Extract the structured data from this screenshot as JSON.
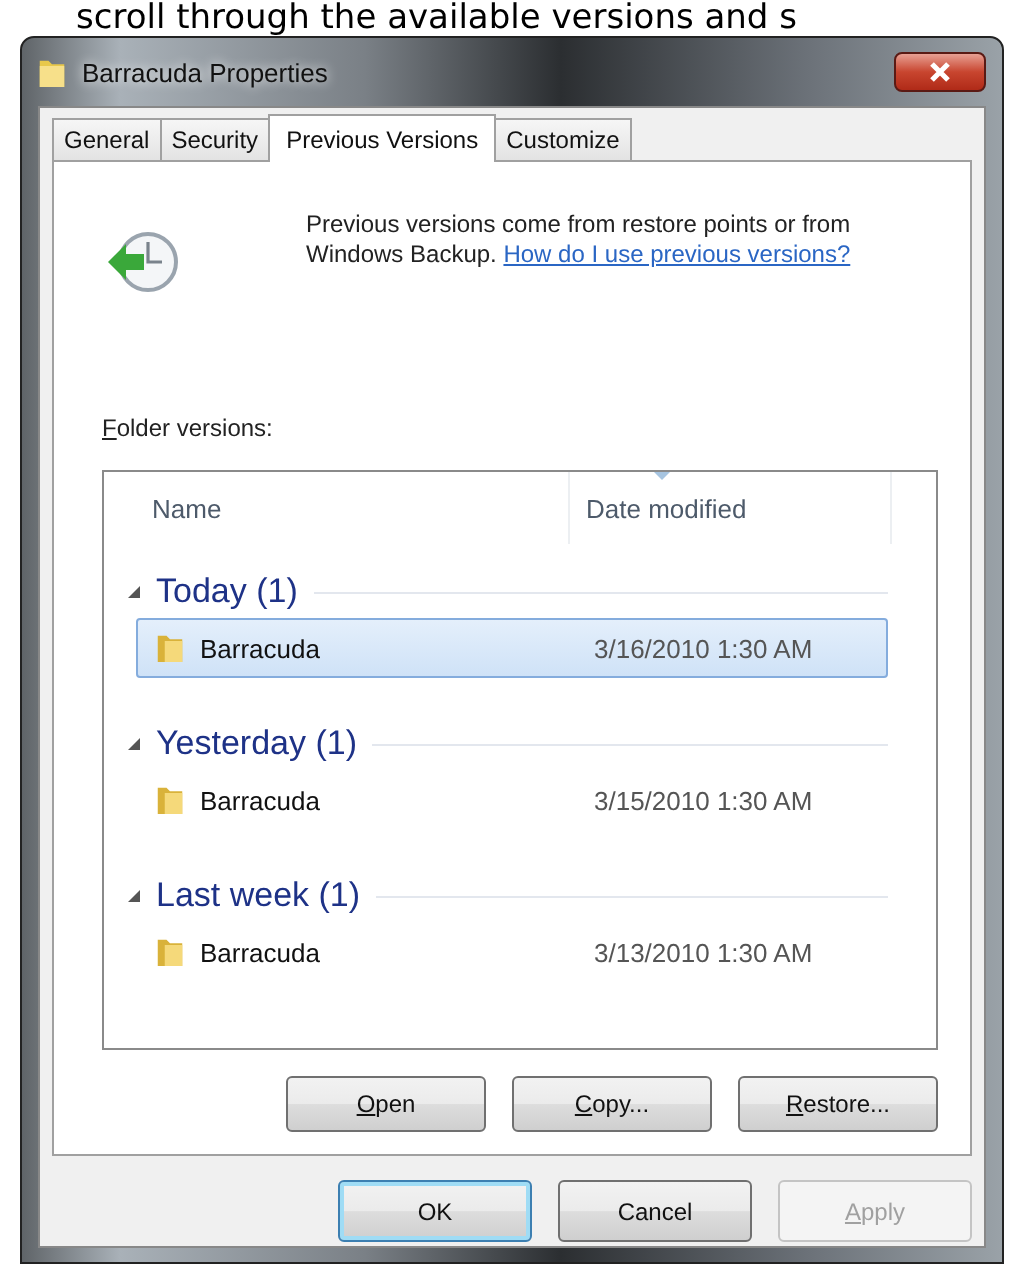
{
  "page_text": "scroll through the available versions and s",
  "window": {
    "title": "Barracuda Properties"
  },
  "tabs": [
    {
      "label": "General",
      "selected": false
    },
    {
      "label": "Security",
      "selected": false
    },
    {
      "label": "Previous Versions",
      "selected": true
    },
    {
      "label": "Customize",
      "selected": false
    }
  ],
  "info": {
    "text": "Previous versions come from restore points or from Windows Backup.",
    "link": "How do I use previous versions?"
  },
  "list_label": {
    "text": "Folder versions:",
    "mnemonic": true
  },
  "columns": [
    "Name",
    "Date modified"
  ],
  "groups": [
    {
      "title": "Today (1)",
      "expanded": true,
      "items": [
        {
          "name": "Barracuda",
          "date": "3/16/2010 1:30 AM",
          "selected": true
        }
      ]
    },
    {
      "title": "Yesterday (1)",
      "expanded": true,
      "items": [
        {
          "name": "Barracuda",
          "date": "3/15/2010 1:30 AM",
          "selected": false
        }
      ]
    },
    {
      "title": "Last week (1)",
      "expanded": true,
      "items": [
        {
          "name": "Barracuda",
          "date": "3/13/2010 1:30 AM",
          "selected": false
        }
      ]
    }
  ],
  "actions": [
    {
      "label": "Open",
      "mnemonic": true,
      "disabled": false
    },
    {
      "label": "Copy...",
      "mnemonic": true,
      "disabled": false
    },
    {
      "label": "Restore...",
      "mnemonic": true,
      "disabled": false
    }
  ],
  "buttons": [
    {
      "label": "OK",
      "default": true,
      "mnemonic": false,
      "disabled": false
    },
    {
      "label": "Cancel",
      "default": false,
      "mnemonic": false,
      "disabled": false
    },
    {
      "label": "Apply",
      "default": false,
      "mnemonic": true,
      "disabled": true
    }
  ]
}
